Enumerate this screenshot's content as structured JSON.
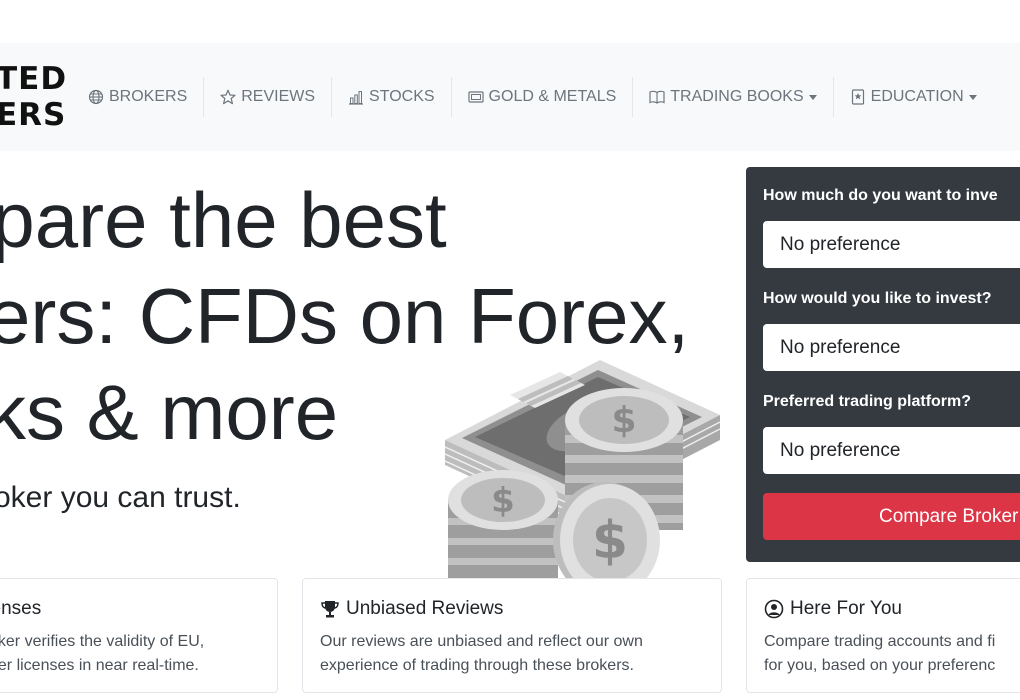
{
  "logo": {
    "line1": "TED",
    "line2": "ERS"
  },
  "nav": [
    {
      "label": "BROKERS",
      "icon": "globe-icon",
      "dropdown": false
    },
    {
      "label": "REVIEWS",
      "icon": "star-icon",
      "dropdown": false
    },
    {
      "label": "STOCKS",
      "icon": "bar-chart-icon",
      "dropdown": false
    },
    {
      "label": "GOLD & METALS",
      "icon": "gold-bar-icon",
      "dropdown": false
    },
    {
      "label": "TRADING BOOKS",
      "icon": "book-icon",
      "dropdown": true
    },
    {
      "label": "EDUCATION",
      "icon": "bookmark-icon",
      "dropdown": true
    }
  ],
  "hero": {
    "line1": "npare the best",
    "line2": "kers: CFDs on Forex,",
    "line3": "cks & more",
    "subtitle": "oker you can trust."
  },
  "form": {
    "q1": "How much do you want to inve",
    "a1": "No preference",
    "q2": "How would you like to invest?",
    "a2": "No preference",
    "q3": "Preferred trading platform?",
    "a3": "No preference",
    "button": "Compare Broker"
  },
  "features": [
    {
      "title": "censes",
      "icon": "",
      "lines": [
        "ecker verifies the validity of EU,",
        "oker licenses in near real-time."
      ]
    },
    {
      "title": "Unbiased Reviews",
      "icon": "trophy-icon",
      "lines": [
        "Our reviews are unbiased and reflect our own",
        "experience of trading through these brokers."
      ]
    },
    {
      "title": "Here For You",
      "icon": "user-circle-icon",
      "lines": [
        "Compare trading accounts and fi",
        "for you, based on your preferenc"
      ]
    }
  ],
  "colors": {
    "dark": "#343a40",
    "accent": "#dc3545",
    "navbg": "#f8f9fa",
    "muted": "#6c757d"
  }
}
